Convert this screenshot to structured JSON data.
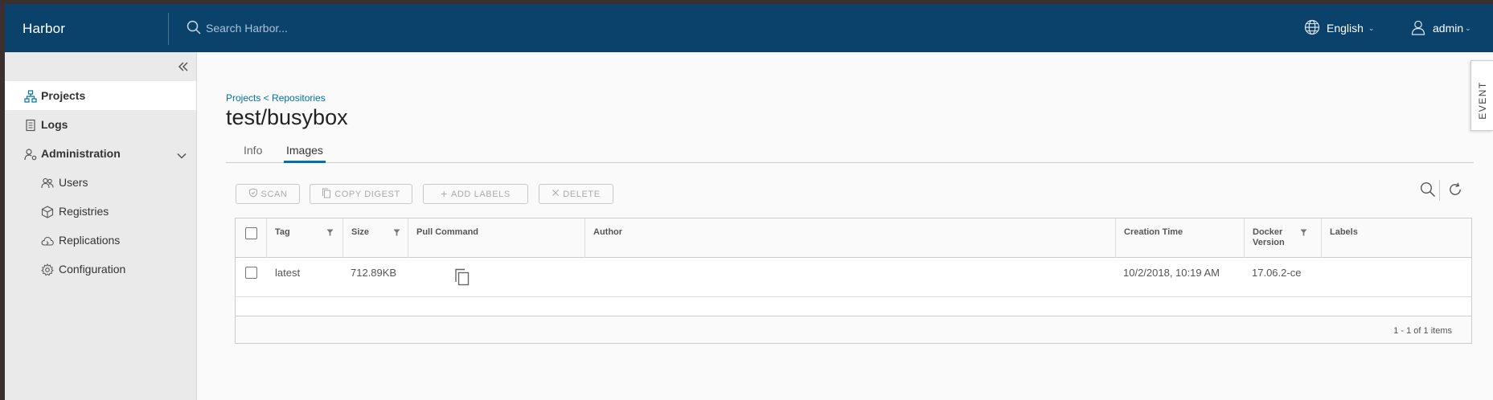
{
  "header": {
    "brand": "Harbor",
    "search_placeholder": "Search Harbor...",
    "language": "English",
    "user": "admin"
  },
  "sidebar": {
    "items": [
      {
        "label": "Projects",
        "icon": "projects-icon",
        "active": true
      },
      {
        "label": "Logs",
        "icon": "logs-icon"
      },
      {
        "label": "Administration",
        "icon": "administration-icon",
        "expanded": true
      },
      {
        "label": "Users",
        "icon": "users-icon"
      },
      {
        "label": "Registries",
        "icon": "registries-icon"
      },
      {
        "label": "Replications",
        "icon": "replications-icon"
      },
      {
        "label": "Configuration",
        "icon": "configuration-icon"
      }
    ]
  },
  "event_tab": "EVENT",
  "main": {
    "breadcrumb": "Projects < Repositories",
    "title": "test/busybox",
    "tabs": [
      {
        "label": "Info",
        "active": false
      },
      {
        "label": "Images",
        "active": true
      }
    ],
    "toolbar": {
      "scan": "SCAN",
      "copy_digest": "COPY DIGEST",
      "add_labels": "ADD LABELS",
      "delete": "DELETE"
    },
    "table": {
      "columns": [
        "Tag",
        "Size",
        "Pull Command",
        "Author",
        "Creation Time",
        "Docker Version",
        "Labels"
      ],
      "docker_version_line1": "Docker",
      "docker_version_line2": "Version",
      "rows": [
        {
          "tag": "latest",
          "size": "712.89KB",
          "pull_command": "",
          "author": "",
          "creation_time": "10/2/2018, 10:19 AM",
          "docker_version": "17.06.2-ce",
          "labels": ""
        }
      ],
      "pagination": "1 - 1 of 1 items"
    }
  },
  "colors": {
    "header_bg": "#0a426c",
    "accent": "#0072a3",
    "sidebar_bg": "#eaeaea"
  }
}
